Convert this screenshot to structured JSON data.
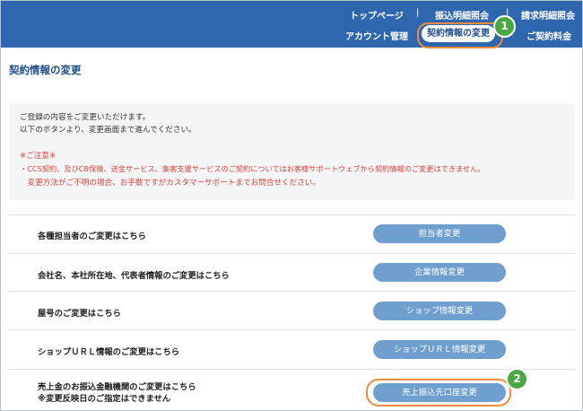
{
  "header": {
    "nav_top": [
      "トップページ",
      "振込明細照会",
      "請求明細照会"
    ],
    "nav_bottom": [
      "アカウント管理",
      "契約情報の変更",
      "ご契約料金"
    ],
    "separators": [
      "|",
      "|"
    ]
  },
  "page": {
    "title": "契約情報の変更",
    "info": {
      "lines": [
        "ご登録の内容をご変更いただけます。",
        "以下のボタンより、変更画面まで進んでください。"
      ],
      "notice_title": "※ご注意※",
      "notice_lines": [
        "・CCS契約、及びCB保険、送金サービス、集客支援サービスのご契約についてはお客様サポートウェブから契約情報のご変更はできません。",
        "　変更方法がご不明の場合、お手数ですがカスタマーサポートまでお問合せください。"
      ]
    },
    "rows": [
      {
        "label": "各種担当者のご変更はこちら",
        "button": "担当者変更"
      },
      {
        "label": "会社名、本社所在地、代表者情報のご変更はこちら",
        "button": "企業情報変更"
      },
      {
        "label": "屋号のご変更はこちら",
        "button": "ショップ情報変更"
      },
      {
        "label": "ショップＵＲＬ情報のご変更はこちら",
        "button": "ショップＵＲＬ情報変更"
      },
      {
        "label": "売上金のお振込金融機関のご変更はこちら",
        "label_note": "※変更反映日のご指定はできません",
        "button": "売上振込先口座変更"
      }
    ]
  },
  "annotations": {
    "badge1": "1",
    "badge2": "2",
    "highlight_color": "#f08a3c",
    "badge_color": "#4aa843"
  },
  "colors": {
    "header_bg": "#2f67ae",
    "button_bg": "#6f9fcf",
    "title_color": "#1f4f8f",
    "warning": "#d9443b"
  }
}
